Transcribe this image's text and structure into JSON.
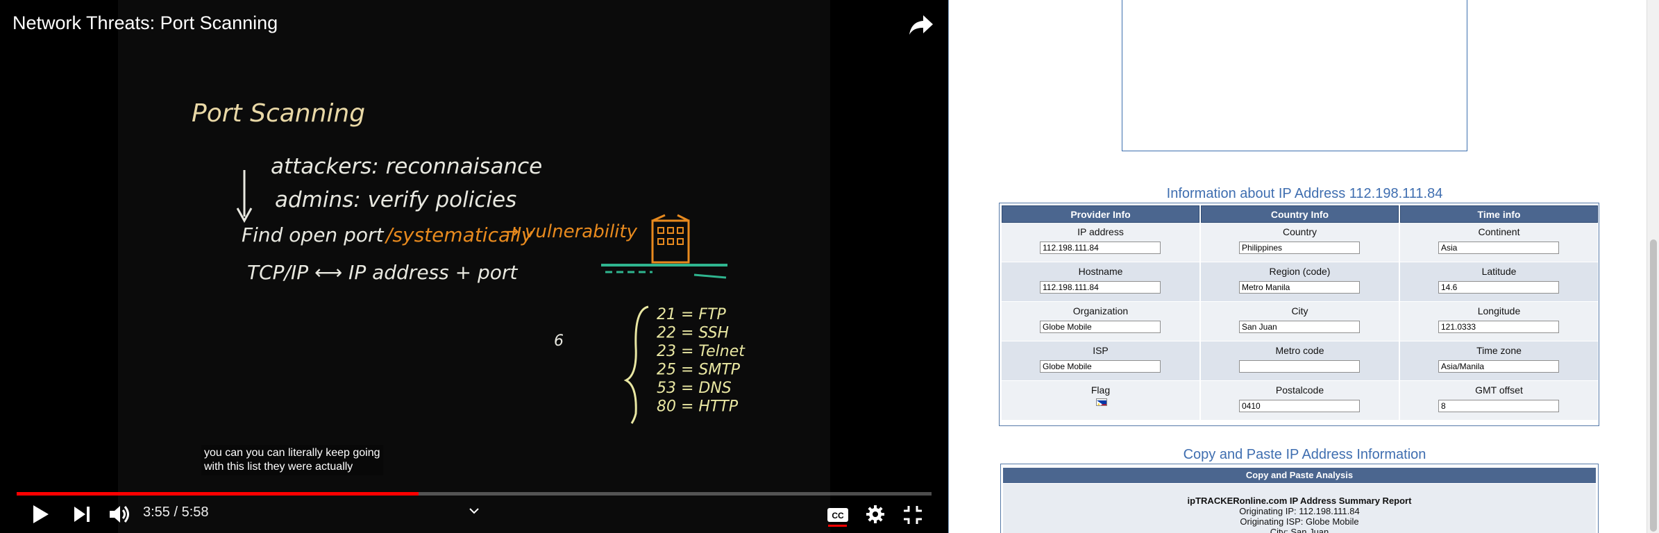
{
  "player": {
    "title": "Network Threats: Port Scanning",
    "captions": [
      "you can you can literally keep going",
      "with this list they were actually"
    ],
    "time": "3:55 / 5:58",
    "progress_fraction": 0.4396,
    "board": {
      "heading": "Port Scanning",
      "line1": "attackers: reconnaisance",
      "line2": "admins: verify policies",
      "line3a": "Find open port",
      "line3b": "/systematically",
      "line3c": "→ vulnerability",
      "line4": "TCP/IP ⟷ IP address + port",
      "ports": [
        "21 = FTP",
        "22 = SSH",
        "23 = Telnet",
        "25 = SMTP",
        "53 = DNS",
        "80 = HTTP"
      ],
      "stray": "6"
    },
    "colors": {
      "chalk": "#e8e8e0",
      "heading": "#e9d8a6",
      "orange": "#e88a1e",
      "green": "#2fb58f",
      "yellow": "#e9e7a2",
      "progress": "#ff0000"
    },
    "icons": [
      "share-icon",
      "play-icon",
      "next-icon",
      "volume-icon",
      "chevron-down-icon",
      "cc-icon",
      "gear-icon",
      "fullscreen-exit-icon"
    ]
  },
  "page": {
    "info_heading": "Information about IP Address 112.198.111.84",
    "columns": [
      {
        "header": "Provider Info",
        "rows": [
          {
            "label": "IP address",
            "value": "112.198.111.84"
          },
          {
            "label": "Hostname",
            "value": "112.198.111.84"
          },
          {
            "label": "Organization",
            "value": "Globe Mobile"
          },
          {
            "label": "ISP",
            "value": "Globe Mobile"
          },
          {
            "label": "Flag",
            "value": ""
          }
        ]
      },
      {
        "header": "Country Info",
        "rows": [
          {
            "label": "Country",
            "value": "Philippines"
          },
          {
            "label": "Region (code)",
            "value": "Metro Manila"
          },
          {
            "label": "City",
            "value": "San Juan"
          },
          {
            "label": "Metro code",
            "value": ""
          },
          {
            "label": "Postalcode",
            "value": "0410"
          }
        ]
      },
      {
        "header": "Time info",
        "rows": [
          {
            "label": "Continent",
            "value": "Asia"
          },
          {
            "label": "Latitude",
            "value": "14.6"
          },
          {
            "label": "Longitude",
            "value": "121.0333"
          },
          {
            "label": "Time zone",
            "value": "Asia/Manila"
          },
          {
            "label": "GMT offset",
            "value": "8"
          }
        ]
      }
    ],
    "copy_heading": "Copy and Paste IP Address Information",
    "copy_box_header": "Copy and Paste Analysis",
    "report": {
      "title": "ipTRACKERonline.com IP Address Summary Report",
      "lines": [
        "Originating IP: 112.198.111.84",
        "Originating ISP: Globe Mobile",
        "City: San Juan"
      ]
    },
    "colors": {
      "heading": "#3f6eb0",
      "table_header": "#4b668f"
    }
  }
}
